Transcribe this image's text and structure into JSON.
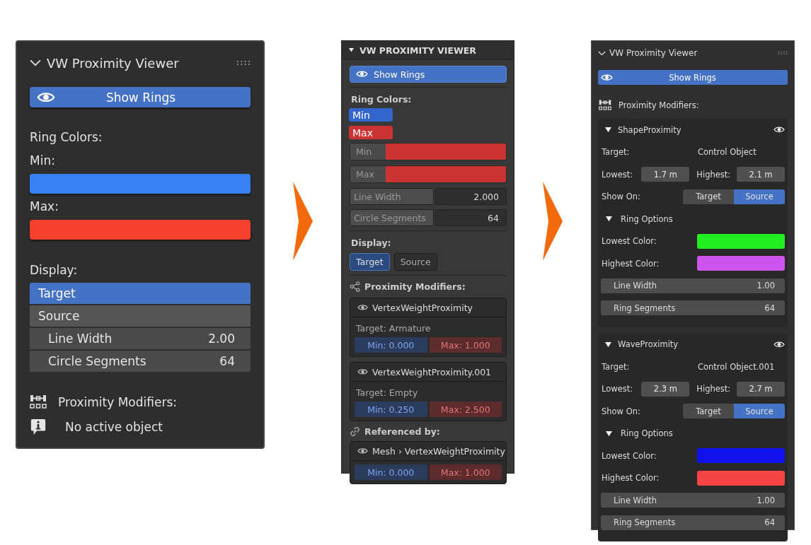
{
  "panel_1": {
    "title": "VW Proximity Viewer",
    "show_rings": {
      "label": "Show Rings",
      "on": true
    },
    "ring_colors_label": "Ring Colors:",
    "colors": [
      {
        "label": "Min:",
        "color": "#3a80f5"
      },
      {
        "label": "Max:",
        "color": "#f5402f"
      }
    ],
    "display_label": "Display:",
    "display_options": [
      {
        "label": "Target",
        "selected": true
      },
      {
        "label": "Source",
        "selected": false
      }
    ],
    "fields": [
      {
        "label": "Line Width",
        "value": "2.00"
      },
      {
        "label": "Circle Segments",
        "value": "64"
      }
    ],
    "modifiers_label": "Proximity Modifiers:",
    "info": "No active object"
  },
  "panel_2": {
    "title": "VW PROXIMITY VIEWER",
    "show_rings": {
      "label": "Show Rings",
      "on": true
    },
    "ring_colors_label": "Ring Colors:",
    "color_tags": [
      {
        "label": "Min",
        "color": "#3366cc"
      },
      {
        "label": "Max",
        "color": "#cc3333"
      }
    ],
    "color_fields": [
      {
        "label": "Min",
        "color": "#cc3333"
      },
      {
        "label": "Max",
        "color": "#cc3333"
      }
    ],
    "fields": [
      {
        "label": "Line Width",
        "value": "2.000"
      },
      {
        "label": "Circle Segments",
        "value": "64"
      }
    ],
    "display_label": "Display:",
    "display_options": [
      {
        "label": "Target",
        "selected": true
      },
      {
        "label": "Source",
        "selected": false
      }
    ],
    "modifiers_label": "Proximity Modifiers:",
    "modifiers": [
      {
        "name": "VertexWeightProximity",
        "target": "Target: Armature",
        "min": "Min: 0.000",
        "max": "Max: 1.000"
      },
      {
        "name": "VertexWeightProximity.001",
        "target": "Target: Empty",
        "min": "Min: 0.250",
        "max": "Max: 2.500"
      }
    ],
    "referenced_label": "Referenced by:",
    "references": [
      {
        "name": "Mesh › VertexWeightProximity",
        "min": "Min: 0.000",
        "max": "Max: 1.000"
      }
    ]
  },
  "panel_3": {
    "title": "VW Proximity Viewer",
    "show_rings": {
      "label": "Show Rings",
      "on": true
    },
    "modifiers_label": "Proximity Modifiers:",
    "modifiers": [
      {
        "name": "ShapeProximity",
        "expanded": true,
        "target_label": "Target:",
        "target": "Control Object",
        "lowest_label": "Lowest:",
        "lowest": "1.7 m",
        "highest_label": "Highest:",
        "highest": "2.1 m",
        "show_on_label": "Show On:",
        "show_on": [
          {
            "label": "Target",
            "selected": false
          },
          {
            "label": "Source",
            "selected": true
          }
        ],
        "ring_options": {
          "label": "Ring Options",
          "expanded": true
        },
        "colors": [
          {
            "label": "Lowest Color:",
            "color": "#22ee22"
          },
          {
            "label": "Highest Color:",
            "color": "#cc55ee"
          }
        ],
        "fields": [
          {
            "label": "Line Width",
            "value": "1.00"
          },
          {
            "label": "Ring Segments",
            "value": "64"
          }
        ]
      },
      {
        "name": "WaveProximity",
        "expanded": true,
        "target_label": "Target:",
        "target": "Control Object.001",
        "lowest_label": "Lowest:",
        "lowest": "2.3 m",
        "highest_label": "Highest:",
        "highest": "2.7 m",
        "show_on_label": "Show On:",
        "show_on": [
          {
            "label": "Target",
            "selected": false
          },
          {
            "label": "Source",
            "selected": true
          }
        ],
        "ring_options": {
          "label": "Ring Options",
          "expanded": true
        },
        "colors": [
          {
            "label": "Lowest Color:",
            "color": "#1111ee"
          },
          {
            "label": "Highest Color:",
            "color": "#f54444"
          }
        ],
        "fields": [
          {
            "label": "Line Width",
            "value": "1.00"
          },
          {
            "label": "Ring Segments",
            "value": "64"
          }
        ]
      }
    ]
  }
}
